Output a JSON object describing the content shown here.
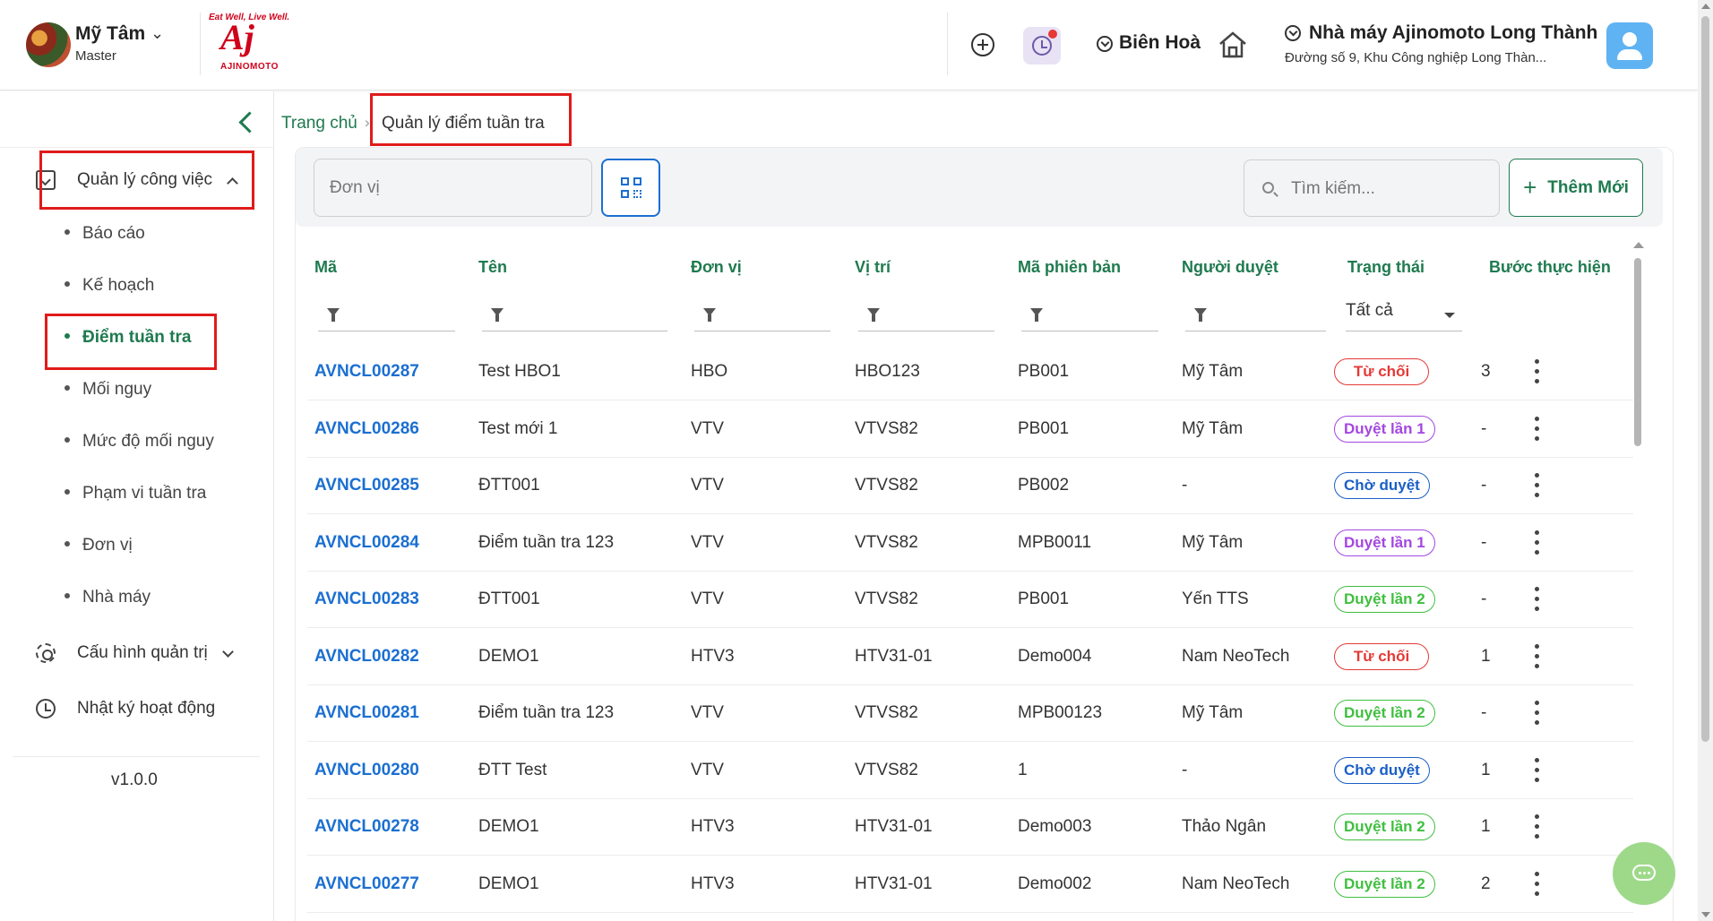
{
  "header": {
    "user_name": "Mỹ Tâm",
    "user_role": "Master",
    "logo_slogan": "Eat Well, Live Well.",
    "logo_mark": "Aj",
    "logo_word": "AJINOMOTO",
    "location": "Biên Hoà",
    "factory_name": "Nhà máy Ajinomoto Long Thành",
    "factory_address": "Đường số 9, Khu Công nghiệp Long Thàn..."
  },
  "sidebar": {
    "groups": [
      {
        "label": "Quản lý công việc",
        "icon": "document-check-icon",
        "expanded": true
      },
      {
        "label": "Cấu hình quản trị",
        "icon": "gear-icon",
        "expanded": false
      },
      {
        "label": "Nhật ký hoạt động",
        "icon": "history-icon"
      }
    ],
    "sub_items": [
      "Báo cáo",
      "Kế hoạch",
      "Điểm tuần tra",
      "Mối nguy",
      "Mức độ mối nguy",
      "Phạm vi tuần tra",
      "Đơn vị",
      "Nhà máy"
    ],
    "active_sub_item": "Điểm tuần tra",
    "version": "v1.0.0"
  },
  "breadcrumb": {
    "home": "Trang chủ",
    "separator": "›",
    "current": "Quản lý điểm tuần tra"
  },
  "toolbar": {
    "unit_placeholder": "Đơn vị",
    "search_placeholder": "Tìm kiếm...",
    "add_label": "Thêm Mới"
  },
  "table": {
    "columns": [
      "Mã",
      "Tên",
      "Đơn vị",
      "Vị trí",
      "Mã phiên bản",
      "Người duyệt",
      "Trạng thái",
      "Bước thực hiện"
    ],
    "status_filter": "Tất cả",
    "rows": [
      {
        "code": "AVNCL00287",
        "name": "Test HBO1",
        "unit": "HBO",
        "location": "HBO123",
        "version": "PB001",
        "approver": "Mỹ Tâm",
        "status": "Từ chối",
        "step": "3"
      },
      {
        "code": "AVNCL00286",
        "name": "Test mới 1",
        "unit": "VTV",
        "location": "VTVS82",
        "version": "PB001",
        "approver": "Mỹ Tâm",
        "status": "Duyệt lần 1",
        "step": "-"
      },
      {
        "code": "AVNCL00285",
        "name": "ĐTT001",
        "unit": "VTV",
        "location": "VTVS82",
        "version": "PB002",
        "approver": "-",
        "status": "Chờ duyệt",
        "step": "-"
      },
      {
        "code": "AVNCL00284",
        "name": "Điểm tuần tra 123",
        "unit": "VTV",
        "location": "VTVS82",
        "version": "MPB0011",
        "approver": "Mỹ Tâm",
        "status": "Duyệt lần 1",
        "step": "-"
      },
      {
        "code": "AVNCL00283",
        "name": "ĐTT001",
        "unit": "VTV",
        "location": "VTVS82",
        "version": "PB001",
        "approver": "Yến TTS",
        "status": "Duyệt lần 2",
        "step": "-"
      },
      {
        "code": "AVNCL00282",
        "name": "DEMO1",
        "unit": "HTV3",
        "location": "HTV31-01",
        "version": "Demo004",
        "approver": "Nam NeoTech",
        "status": "Từ chối",
        "step": "1"
      },
      {
        "code": "AVNCL00281",
        "name": "Điểm tuần tra 123",
        "unit": "VTV",
        "location": "VTVS82",
        "version": "MPB00123",
        "approver": "Mỹ Tâm",
        "status": "Duyệt lần 2",
        "step": "-"
      },
      {
        "code": "AVNCL00280",
        "name": "ĐTT Test",
        "unit": "VTV",
        "location": "VTVS82",
        "version": "1",
        "approver": "-",
        "status": "Chờ duyệt",
        "step": "1"
      },
      {
        "code": "AVNCL00278",
        "name": "DEMO1",
        "unit": "HTV3",
        "location": "HTV31-01",
        "version": "Demo003",
        "approver": "Thảo Ngân",
        "status": "Duyệt lần 2",
        "step": "1"
      },
      {
        "code": "AVNCL00277",
        "name": "DEMO1",
        "unit": "HTV3",
        "location": "HTV31-01",
        "version": "Demo002",
        "approver": "Nam NeoTech",
        "status": "Duyệt lần 2",
        "step": "2"
      }
    ]
  },
  "status_colors": {
    "Từ chối": "#e53935",
    "Duyệt lần 1": "#a347e0",
    "Chờ duyệt": "#1b5fc7",
    "Duyệt lần 2": "#3fbf3f"
  },
  "colors": {
    "brand_green": "#1f7a4f",
    "link_blue": "#1b6fd1",
    "highlight_red": "#e01b1b"
  }
}
